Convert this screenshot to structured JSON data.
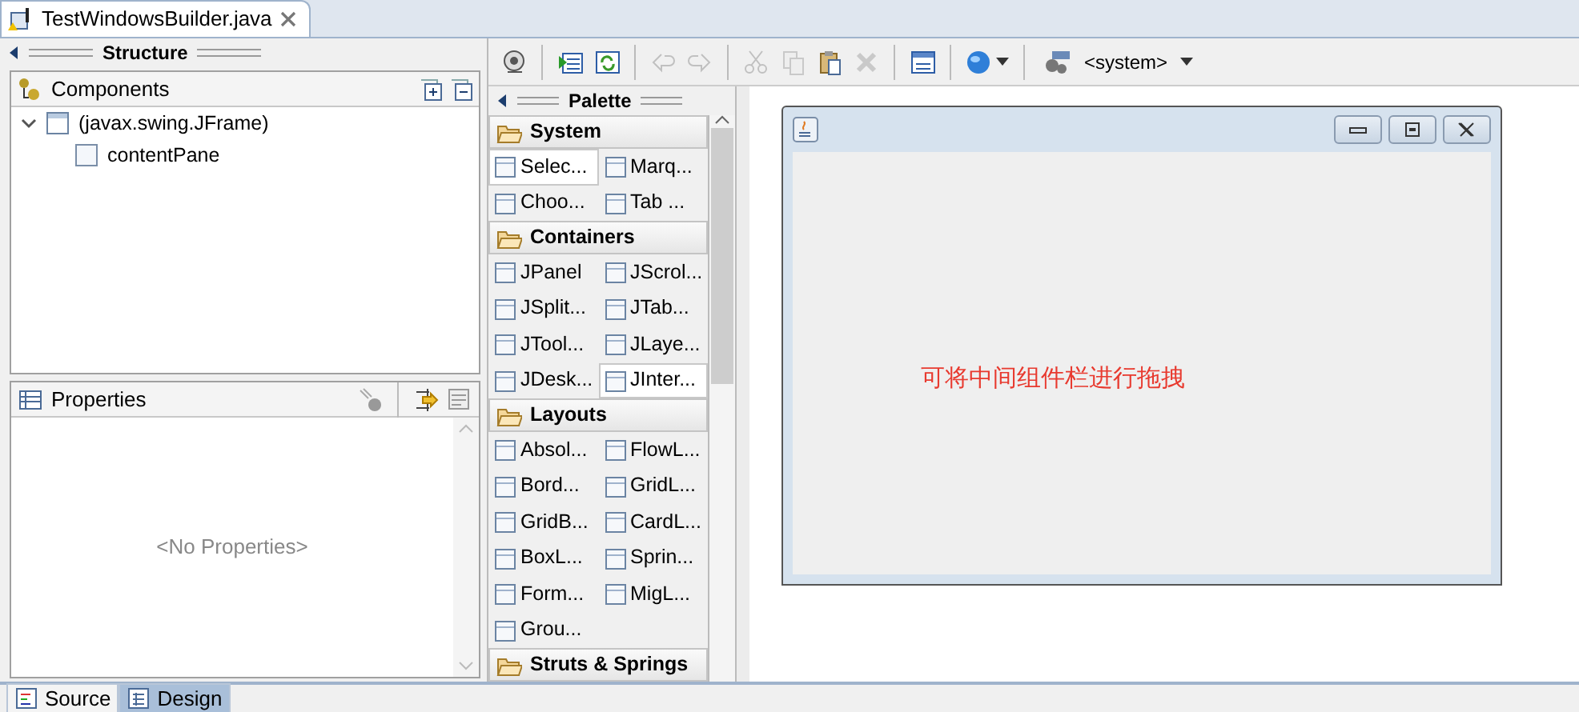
{
  "editor_tab": {
    "title": "TestWindowsBuilder.java"
  },
  "structure": {
    "title": "Structure"
  },
  "components": {
    "title": "Components",
    "tree": [
      {
        "label": "(javax.swing.JFrame)",
        "expanded": true,
        "children": [
          {
            "label": "contentPane"
          }
        ]
      }
    ]
  },
  "properties": {
    "title": "Properties",
    "empty_text": "<No Properties>"
  },
  "toolbar": [
    {
      "kind": "icon",
      "disabled": false
    },
    {
      "kind": "separator"
    },
    {
      "kind": "icon",
      "disabled": false
    },
    {
      "kind": "icon",
      "disabled": false
    },
    {
      "kind": "separator"
    },
    {
      "kind": "icon",
      "disabled": true
    },
    {
      "kind": "icon",
      "disabled": true
    },
    {
      "kind": "separator"
    },
    {
      "kind": "icon",
      "disabled": true
    },
    {
      "kind": "icon",
      "disabled": true
    },
    {
      "kind": "icon",
      "disabled": false
    },
    {
      "kind": "icon",
      "disabled": true
    },
    {
      "kind": "separator"
    },
    {
      "kind": "icon",
      "disabled": false
    },
    {
      "kind": "separator"
    },
    {
      "kind": "menu",
      "disabled": false
    },
    {
      "kind": "separator"
    },
    {
      "kind": "dropdown",
      "label": "<system>"
    }
  ],
  "palette": {
    "title": "Palette",
    "categories": [
      {
        "label": "System",
        "items": [
          {
            "label": "Selec...",
            "selected": true
          },
          {
            "label": "Marq...",
            "selected": false
          },
          {
            "label": "Choo...",
            "selected": false
          },
          {
            "label": "Tab ...",
            "selected": false
          }
        ]
      },
      {
        "label": "Containers",
        "items": [
          {
            "label": "JPanel",
            "selected": false
          },
          {
            "label": "JScrol...",
            "selected": false
          },
          {
            "label": "JSplit...",
            "selected": false
          },
          {
            "label": "JTab...",
            "selected": false
          },
          {
            "label": "JTool...",
            "selected": false
          },
          {
            "label": "JLaye...",
            "selected": false
          },
          {
            "label": "JDesk...",
            "selected": false
          },
          {
            "label": "JInter...",
            "selected": true
          }
        ]
      },
      {
        "label": "Layouts",
        "items": [
          {
            "label": "Absol...",
            "selected": false
          },
          {
            "label": "FlowL...",
            "selected": false
          },
          {
            "label": "Bord...",
            "selected": false
          },
          {
            "label": "GridL...",
            "selected": false
          },
          {
            "label": "GridB...",
            "selected": false
          },
          {
            "label": "CardL...",
            "selected": false
          },
          {
            "label": "BoxL...",
            "selected": false
          },
          {
            "label": "Sprin...",
            "selected": false
          },
          {
            "label": "Form...",
            "selected": false
          },
          {
            "label": "MigL...",
            "selected": false
          },
          {
            "label": "Grou...",
            "selected": false
          }
        ]
      },
      {
        "label": "Struts & Springs"
      }
    ]
  },
  "frame": {
    "annotation": "可将中间组件栏进行拖拽"
  },
  "bottom_tabs": [
    {
      "label": "Source",
      "selected": false
    },
    {
      "label": "Design",
      "selected": true
    }
  ]
}
